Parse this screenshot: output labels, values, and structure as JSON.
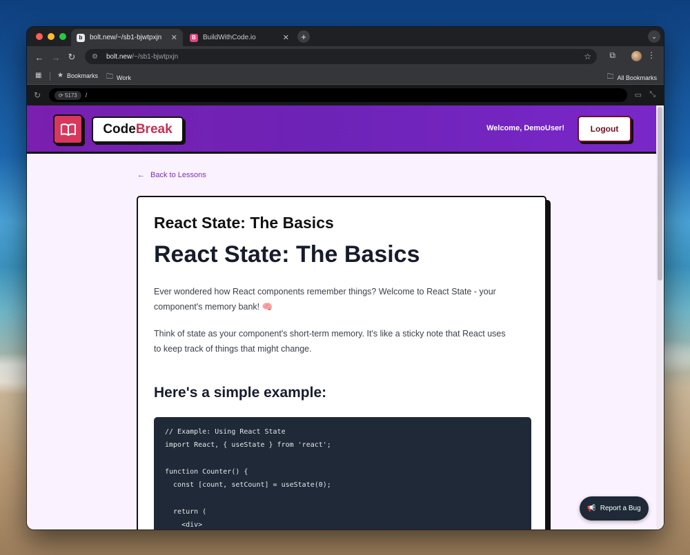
{
  "browser": {
    "tabs": [
      {
        "title": "bolt.new/~/sb1-bjwtpxjn",
        "favicon": "b"
      },
      {
        "title": "BuildWithCode.io",
        "favicon": "B"
      }
    ],
    "address": {
      "host": "bolt.new",
      "path": "/~/sb1-bjwtpxjn"
    },
    "bookmarks": [
      {
        "label": "Bookmarks",
        "icon": "star-icon"
      },
      {
        "label": "Work",
        "icon": "folder-icon"
      }
    ],
    "all_bookmarks": "All Bookmarks",
    "dev_port": "5173",
    "dev_path": "/"
  },
  "app": {
    "brand_code": "Code",
    "brand_break": "Break",
    "welcome": "Welcome, DemoUser!",
    "logout_label": "Logout",
    "back_label": "Back to Lessons",
    "report_bug_label": "Report a Bug"
  },
  "lesson": {
    "title": "React State: The Basics",
    "heading": "React State: The Basics",
    "paragraphs": [
      "Ever wondered how React components remember things? Welcome to React State - your component's memory bank! 🧠",
      "Think of state as your component's short-term memory. It's like a sticky note that React uses to keep track of things that might change."
    ],
    "example_heading": "Here's a simple example:",
    "code": "// Example: Using React State\nimport React, { useState } from 'react';\n\nfunction Counter() {\n  const [count, setCount] = useState(0);\n\n  return (\n    <div>"
  },
  "colors": {
    "header_gradient_start": "#7a1fb0",
    "header_gradient_end": "#7a27c9",
    "logo_red": "#d7385c",
    "brand_break": "#c92e55",
    "page_bg": "#fbf2ff",
    "code_bg": "#1f2937"
  }
}
